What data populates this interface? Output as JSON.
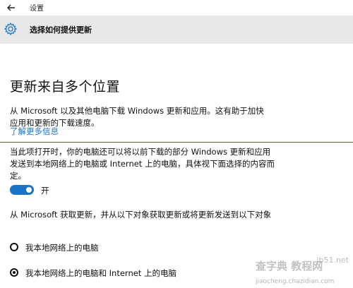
{
  "topbar": {
    "back_icon": "back-arrow-icon",
    "title": "设置"
  },
  "header": {
    "icon": "gear-icon",
    "title": "选择如何提供更新"
  },
  "main": {
    "heading": "更新来自多个位置",
    "description": "从 Microsoft 以及其他电脑下载 Windows 更新和应用。这有助于加快应用和更新的下载速度。",
    "learn_more": "了解更多信息",
    "toggle_description": "当此项打开时，你的电脑还可以将以前下载的部分 Windows 更新和应用发送到本地网络上的电脑或 Internet 上的电脑，具体视下面选择的内容而定。",
    "toggle": {
      "state": "on",
      "label": "开"
    },
    "from_description": "从 Microsoft 获取更新，并从以下对象获取更新或将更新发送到以下对象",
    "options": [
      {
        "label": "我本地网络上的电脑",
        "selected": false
      },
      {
        "label": "我本地网络上的电脑和 Internet 上的电脑",
        "selected": true
      }
    ]
  },
  "watermark": {
    "text1": "查字典 教程网",
    "text2": "jb51.net",
    "text3": "jiaocheng.chazidian.com"
  },
  "colors": {
    "accent": "#1a73c8",
    "header_bg": "#e8e8e8",
    "divider": "#c0392b"
  }
}
